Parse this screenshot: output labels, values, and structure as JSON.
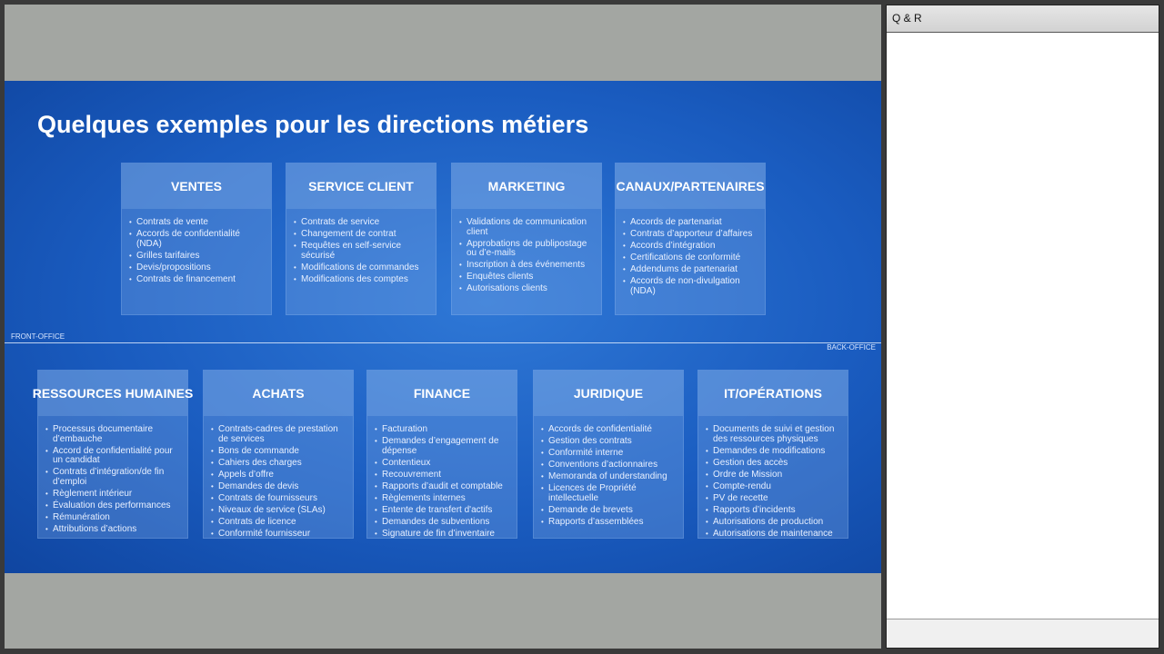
{
  "slide": {
    "title": "Quelques exemples pour les directions métiers",
    "front_label": "FRONT-OFFICE",
    "back_label": "BACK-OFFICE",
    "front": [
      {
        "title": "VENTES",
        "items": [
          "Contrats de vente",
          "Accords de confidentialité (NDA)",
          "Grilles tarifaires",
          "Devis/propositions",
          "Contrats de financement"
        ]
      },
      {
        "title": "SERVICE CLIENT",
        "items": [
          "Contrats de service",
          "Changement de contrat",
          "Requêtes en self-service sécurisé",
          "Modifications de commandes",
          "Modifications des comptes"
        ]
      },
      {
        "title": "MARKETING",
        "items": [
          "Validations de communication client",
          "Approbations de publipostage ou d’e-mails",
          "Inscription à des événements",
          "Enquêtes clients",
          "Autorisations clients"
        ]
      },
      {
        "title": "CANAUX/PARTENAIRES",
        "items": [
          "Accords de partenariat",
          "Contrats d’apporteur d’affaires",
          "Accords d’intégration",
          "Certifications de conformité",
          "Addendums de partenariat",
          "Accords de non-divulgation (NDA)"
        ]
      }
    ],
    "back": [
      {
        "title": "RESSOURCES HUMAINES",
        "items": [
          "Processus documentaire d’embauche",
          "Accord de confidentialité pour un candidat",
          "Contrats d’intégration/de fin d’emploi",
          "Règlement intérieur",
          "Évaluation des performances",
          "Rémunération",
          "Attributions d’actions"
        ]
      },
      {
        "title": "ACHATS",
        "items": [
          "Contrats-cadres de prestation de services",
          "Bons de commande",
          "Cahiers des charges",
          "Appels d’offre",
          "Demandes de devis",
          "Contrats de fournisseurs",
          "Niveaux de service (SLAs)",
          "Contrats de licence",
          "Conformité fournisseur"
        ]
      },
      {
        "title": "FINANCE",
        "items": [
          "Facturation",
          "Demandes d’engagement de dépense",
          "Contentieux",
          "Recouvrement",
          "Rapports d’audit et comptable",
          "Règlements internes",
          "Entente de transfert d'actifs",
          "Demandes de subventions",
          "Signature de fin d’inventaire"
        ]
      },
      {
        "title": "JURIDIQUE",
        "items": [
          "Accords de confidentialité",
          "Gestion des contrats",
          "Conformité interne",
          "Conventions d’actionnaires",
          "Memoranda of understanding",
          "Licences de Propriété intellectuelle",
          "Demande de brevets",
          "Rapports d’assemblées"
        ]
      },
      {
        "title": "IT/OPÉRATIONS",
        "items": [
          "Documents de suivi et gestion des ressources physiques",
          "Demandes de modifications",
          "Gestion des accès",
          "Ordre de Mission",
          "Compte-rendu",
          "PV de recette",
          "Rapports d’incidents",
          "Autorisations de production",
          "Autorisations de maintenance"
        ]
      }
    ]
  },
  "qa": {
    "title": "Q & R"
  }
}
